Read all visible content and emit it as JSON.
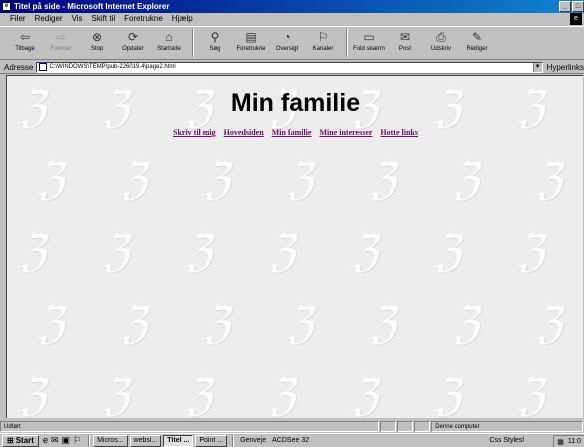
{
  "window": {
    "title": "Titel på side - Microsoft Internet Explorer",
    "controls": [
      "_",
      "□"
    ]
  },
  "menu": [
    "Filer",
    "Rediger",
    "Vis",
    "Skift til",
    "Foretrukne",
    "Hjælp"
  ],
  "toolbar": [
    {
      "label": "Tilbage",
      "icon": "back-icon",
      "glyph": "⇦",
      "disabled": false
    },
    {
      "label": "Fremad",
      "icon": "forward-icon",
      "glyph": "⇨",
      "disabled": true
    },
    {
      "label": "Stop",
      "icon": "stop-icon",
      "glyph": "⊗",
      "disabled": false
    },
    {
      "label": "Opdater",
      "icon": "refresh-icon",
      "glyph": "⟳",
      "disabled": false
    },
    {
      "label": "Startside",
      "icon": "home-icon",
      "glyph": "⌂",
      "disabled": false
    },
    {
      "label": "Søg",
      "icon": "search-icon",
      "glyph": "⚲",
      "disabled": false
    },
    {
      "label": "Foretrukne",
      "icon": "favorites-icon",
      "glyph": "▤",
      "disabled": false
    },
    {
      "label": "Oversigt",
      "icon": "history-icon",
      "glyph": "◔",
      "disabled": false
    },
    {
      "label": "Kanaler",
      "icon": "channels-icon",
      "glyph": "⚐",
      "disabled": false
    },
    {
      "label": "Fuld skærm",
      "icon": "fullscreen-icon",
      "glyph": "▭",
      "disabled": false
    },
    {
      "label": "Post",
      "icon": "mail-icon",
      "glyph": "✉",
      "disabled": false
    },
    {
      "label": "Udskriv",
      "icon": "print-icon",
      "glyph": "⎙",
      "disabled": false
    },
    {
      "label": "Rediger",
      "icon": "edit-icon",
      "glyph": "✎",
      "disabled": false
    }
  ],
  "address": {
    "label": "Adresse",
    "value": "C:\\WINDOWS\\TEMP\\pub-226019.4\\page2.html",
    "links_label": "Hyperlinks"
  },
  "page": {
    "title": "Min familie",
    "links": [
      "Skriv til mig",
      "Hovedsiden",
      "Min familie",
      "Mine interesser",
      "Hotte links"
    ],
    "watermark_glyph": "ℨ"
  },
  "status": {
    "text": "Udført",
    "zone": "Denne computer"
  },
  "taskbar": {
    "start": "Start",
    "tasks": [
      "Micros...",
      "websi...",
      "Titel ...",
      "Point ..."
    ],
    "active_task": "Titel ...",
    "genveje": "Genveje",
    "acdsee": "ACDSee 32",
    "css": "Css Stylesl",
    "clock": "11:0"
  },
  "colors": {
    "titlebar": "#000080",
    "link": "#6a0a6a",
    "page_bg": "#ececec"
  }
}
